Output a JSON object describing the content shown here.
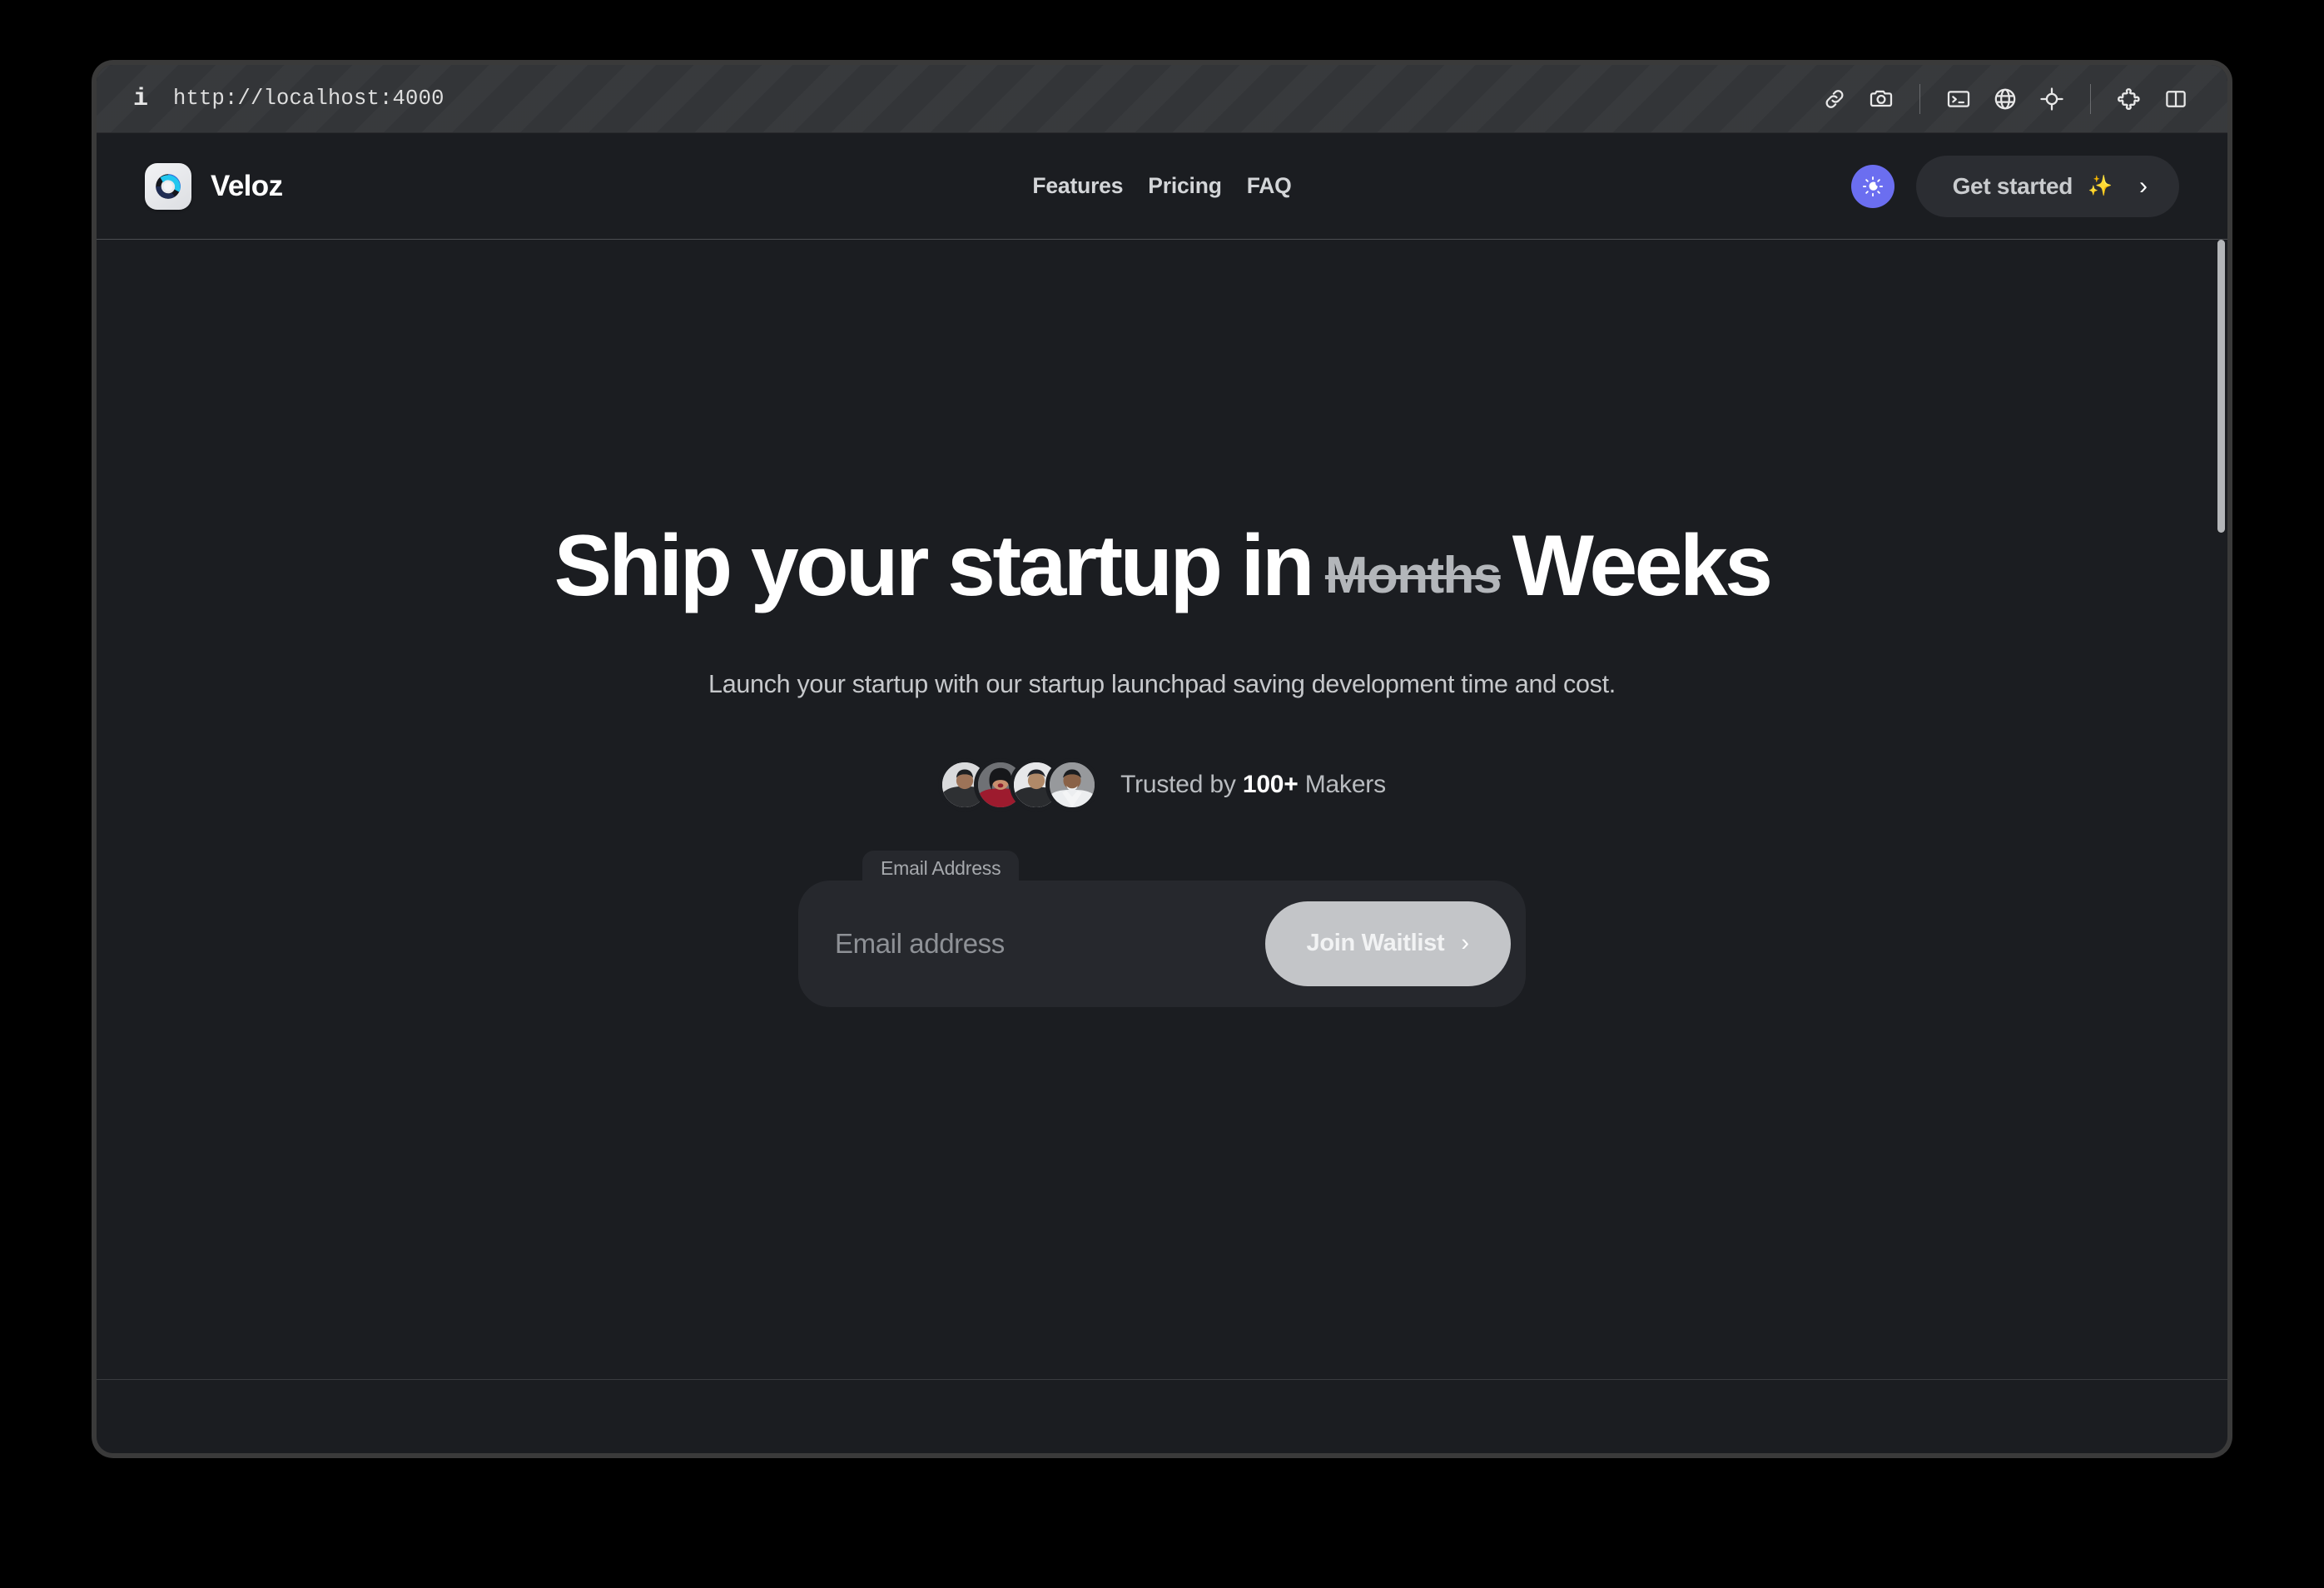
{
  "browser": {
    "info_icon": "info-icon",
    "url": "http://localhost:4000",
    "actions": [
      {
        "name": "link-icon",
        "title": "Copy link"
      },
      {
        "name": "camera-icon",
        "title": "Screenshot"
      },
      {
        "name": "terminal-icon",
        "title": "Console"
      },
      {
        "name": "globe-icon",
        "title": "Network"
      },
      {
        "name": "crosshair-icon",
        "title": "Inspect element"
      },
      {
        "name": "puzzle-piece-icon",
        "title": "Extensions"
      },
      {
        "name": "split-panel-icon",
        "title": "Toggle panel"
      }
    ]
  },
  "site": {
    "brand": {
      "name": "Veloz",
      "logo_icon": "veloz-swirl-logo",
      "logo_colors": {
        "cyan": "#22c7ef",
        "blue": "#2f6fe0",
        "navy": "#1f2c52",
        "dark": "#14161c",
        "tile": "#e9ebee"
      }
    },
    "nav": [
      {
        "label": "Features"
      },
      {
        "label": "Pricing"
      },
      {
        "label": "FAQ"
      }
    ],
    "theme_toggle": {
      "icon": "moon-with-rays-icon",
      "color": "#6b6ef0"
    },
    "cta": {
      "label": "Get started",
      "sparkle": "✨",
      "chevron": "›"
    }
  },
  "hero": {
    "title_before": "Ship your startup in",
    "title_strikethrough": "Months",
    "title_after": "Weeks",
    "subtitle": "Launch your startup with our startup launchpad saving development time and cost.",
    "social_proof": {
      "avatar_count": 4,
      "text_before": "Trusted by ",
      "count": "100+",
      "text_after": " Makers"
    },
    "form": {
      "label": "Email Address",
      "placeholder": "Email address",
      "value": "",
      "submit_label": "Join Waitlist",
      "submit_chevron": "›"
    }
  },
  "colors": {
    "page_bg": "#1b1d21",
    "chrome_bg": "#333538",
    "card_bg": "#26282d",
    "accent_purple": "#6b6ef0",
    "submit_bg": "#c3c5c8",
    "muted_text": "#b9bcc0"
  }
}
